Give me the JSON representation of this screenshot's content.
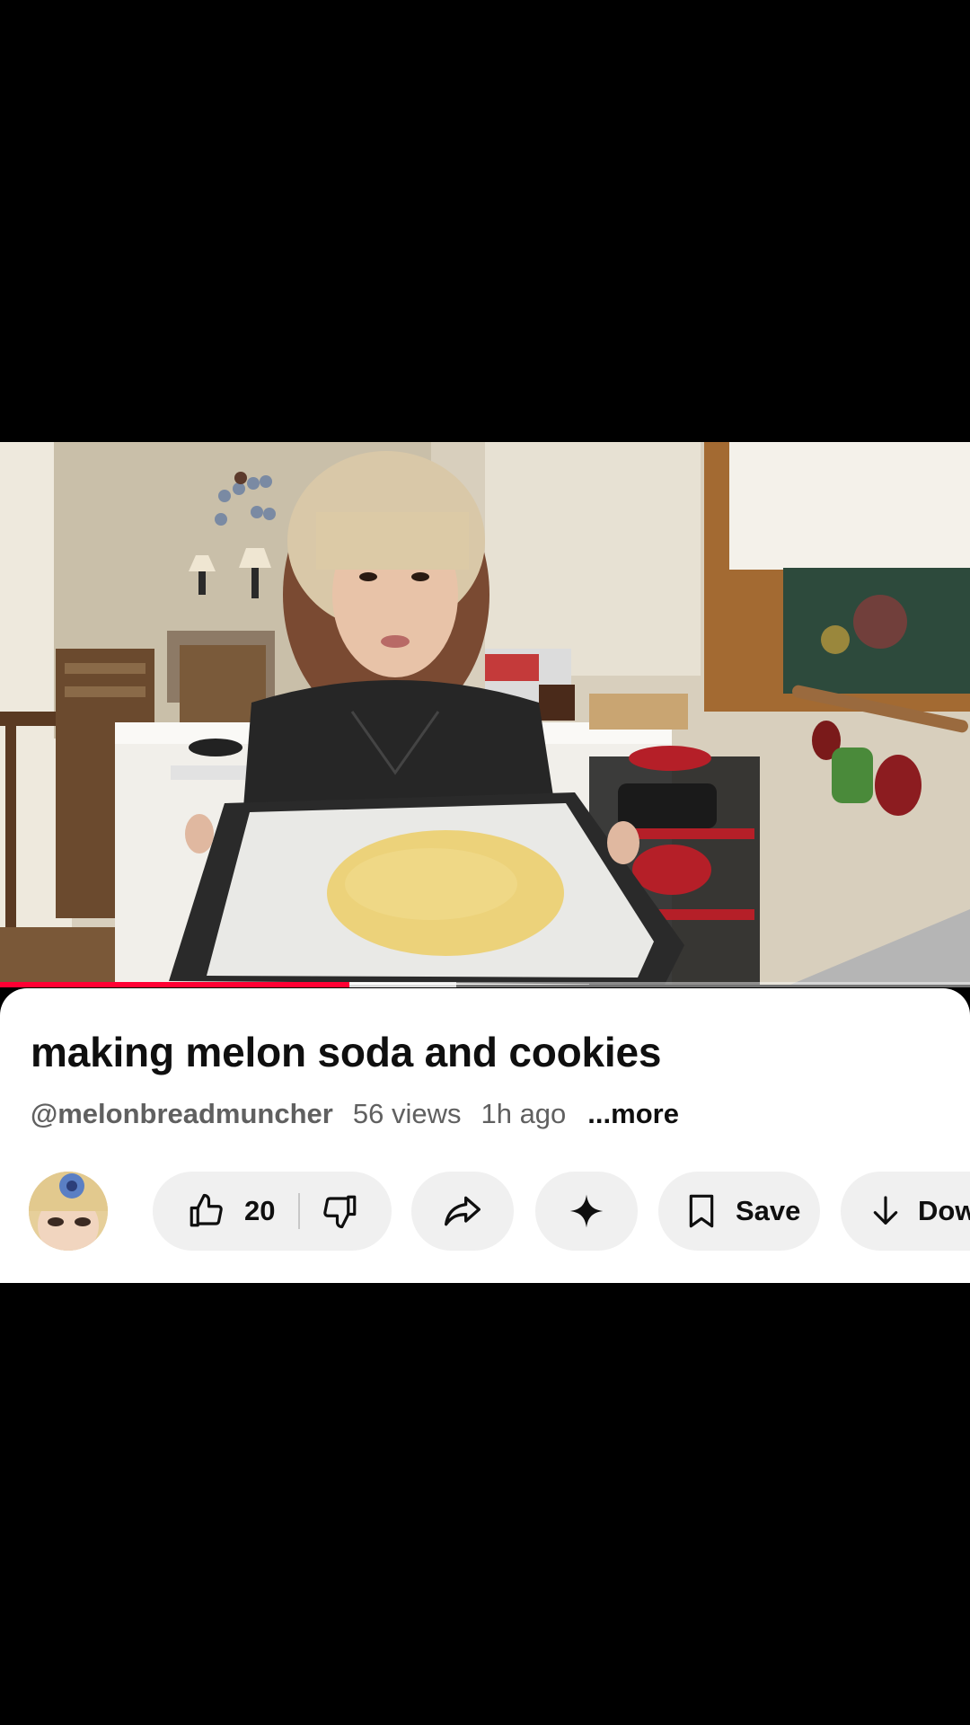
{
  "video": {
    "title": "making melon soda and cookies",
    "progress_fraction": 0.36,
    "buffered_fraction": 0.47
  },
  "meta": {
    "channel_handle": "@melonbreadmuncher",
    "views": "56 views",
    "age": "1h ago",
    "more_label": "...more"
  },
  "actions": {
    "like_count": "20",
    "save_label": "Save",
    "download_label": "Dow"
  },
  "icons": {
    "like": "thumbs-up-icon",
    "dislike": "thumbs-down-icon",
    "share": "share-arrow-icon",
    "ask": "sparkle-icon",
    "save": "bookmark-icon",
    "download": "download-arrow-icon"
  },
  "colors": {
    "progress": "#ff0033",
    "pill_bg": "#f0f0f0",
    "title_text": "#0f0f0f",
    "meta_text": "#606060"
  }
}
